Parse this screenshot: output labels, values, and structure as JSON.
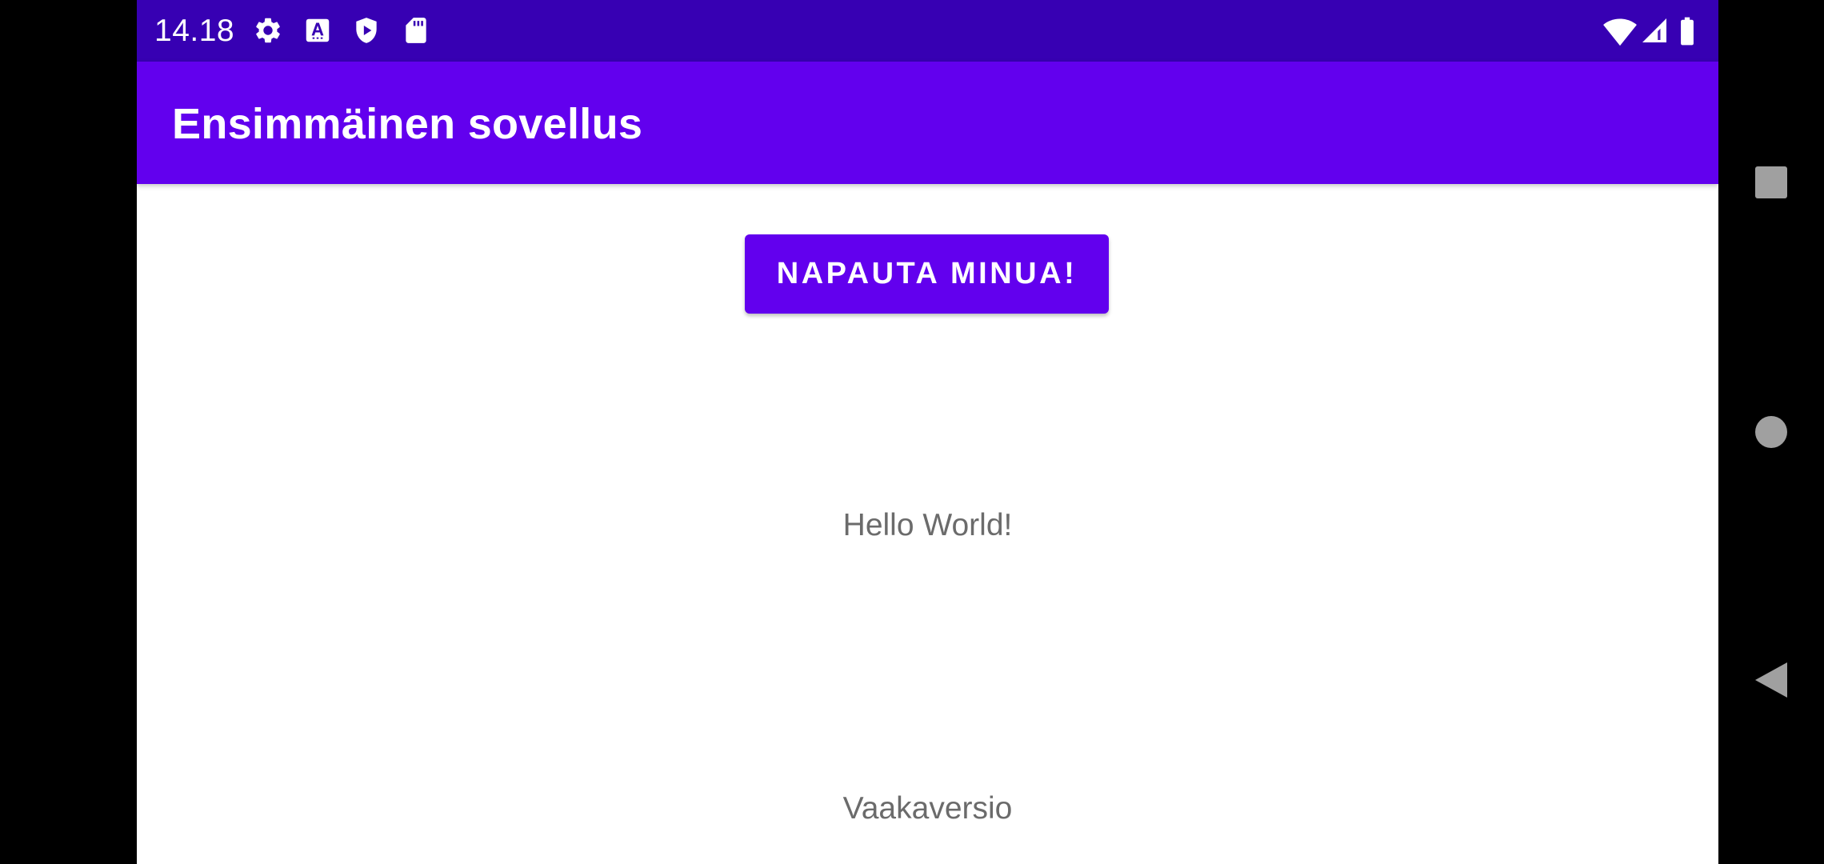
{
  "status_bar": {
    "time": "14.18",
    "left_icons": [
      "settings-icon",
      "font-a-icon",
      "play-shield-icon",
      "sd-card-icon"
    ],
    "right_icons": [
      "wifi-icon",
      "cell-signal-icon",
      "battery-icon"
    ]
  },
  "app_bar": {
    "title": "Ensimmäinen sovellus"
  },
  "main": {
    "button_label": "NAPAUTA MINUA!",
    "hello_text": "Hello World!",
    "version_text": "Vaakaversio"
  },
  "nav_bar": {
    "buttons": [
      "overview-square-icon",
      "home-circle-icon",
      "back-triangle-icon"
    ]
  },
  "colors": {
    "primary": "#6200ee",
    "primary_dark": "#3700b3",
    "text_secondary": "#6b6b6b",
    "nav_icon": "#a0a0a0"
  }
}
